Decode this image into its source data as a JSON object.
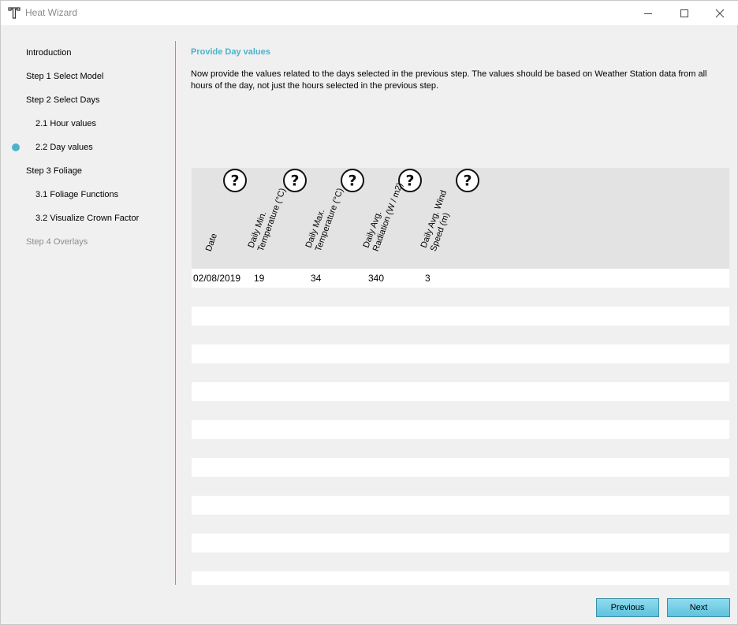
{
  "window": {
    "title": "Heat Wizard",
    "icon": "tygron-t-icon",
    "controls": [
      "minimize-icon",
      "maximize-icon",
      "close-icon"
    ]
  },
  "sidebar": {
    "items": [
      {
        "label": "Introduction",
        "indent": 0,
        "state": "normal"
      },
      {
        "label": "Step 1 Select Model",
        "indent": 0,
        "state": "normal"
      },
      {
        "label": "Step 2 Select Days",
        "indent": 0,
        "state": "normal"
      },
      {
        "label": "2.1 Hour values",
        "indent": 1,
        "state": "normal"
      },
      {
        "label": "2.2 Day values",
        "indent": 1,
        "state": "current"
      },
      {
        "label": "Step 3 Foliage",
        "indent": 0,
        "state": "normal"
      },
      {
        "label": "3.1 Foliage Functions",
        "indent": 1,
        "state": "normal"
      },
      {
        "label": "3.2 Visualize Crown Factor",
        "indent": 1,
        "state": "normal"
      },
      {
        "label": "Step 4 Overlays",
        "indent": 0,
        "state": "disabled"
      }
    ]
  },
  "main": {
    "title": "Provide Day values",
    "description": "Now provide the values related to the days selected in the previous step. The values should be based on Weather Station data from all hours of the day, not just the hours selected in the previous step."
  },
  "table": {
    "columns": [
      {
        "line1": "Date",
        "line2": "",
        "help": false
      },
      {
        "line1": "Daily Min.",
        "line2": "Temperature (°C)",
        "help": true
      },
      {
        "line1": "Daily Max.",
        "line2": "Temperature (°C)",
        "help": true
      },
      {
        "line1": "Daily Avg.",
        "line2": "Radiation (W / m2)",
        "help": true
      },
      {
        "line1": "Daily Avg. Wind",
        "line2": "Speed (m)",
        "help": true
      }
    ],
    "rows": [
      [
        "02/08/2019",
        "19",
        "34",
        "340",
        "3"
      ]
    ]
  },
  "buttons": {
    "previous": "Previous",
    "next": "Next"
  },
  "colors": {
    "accent": "#4bb3cc",
    "button_top": "#8fdbee",
    "button_bottom": "#5ec3dd"
  }
}
